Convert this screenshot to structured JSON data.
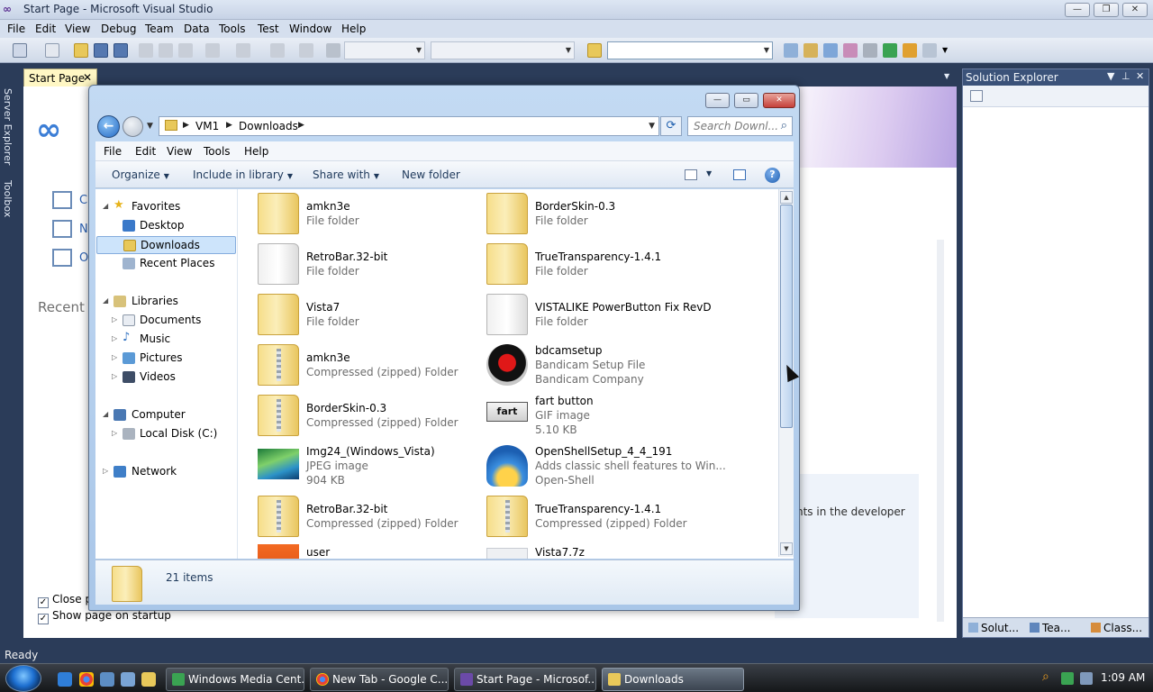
{
  "vs": {
    "window_title": "Start Page - Microsoft Visual Studio",
    "menu": [
      "File",
      "Edit",
      "View",
      "Debug",
      "Team",
      "Data",
      "Tools",
      "Test",
      "Window",
      "Help"
    ],
    "left_rail": [
      "Server Explorer",
      "Toolbox"
    ],
    "doc_tab": "Start Page",
    "start_page": {
      "links": [
        "C",
        "N",
        "O"
      ],
      "recent_label": "Recent P",
      "latest_text": "nts in the developer",
      "close_page_label": "Close p",
      "close_page_checked": true,
      "show_page_label": "Show page on startup",
      "show_page_checked": true
    },
    "solution_explorer": {
      "title": "Solution Explorer",
      "tabs": [
        "Solut...",
        "Tea...",
        "Class..."
      ]
    },
    "status": "Ready"
  },
  "explorer": {
    "breadcrumb": [
      "VM1",
      "Downloads"
    ],
    "search_placeholder": "Search Downl...",
    "menu": [
      "File",
      "Edit",
      "View",
      "Tools",
      "Help"
    ],
    "commands": [
      "Organize",
      "Include in library",
      "Share with",
      "New folder"
    ],
    "nav": {
      "favorites_label": "Favorites",
      "favorites": [
        "Desktop",
        "Downloads",
        "Recent Places"
      ],
      "selected": "Downloads",
      "libraries_label": "Libraries",
      "libraries": [
        "Documents",
        "Music",
        "Pictures",
        "Videos"
      ],
      "computer_label": "Computer",
      "computer_items": [
        "Local Disk (C:)"
      ],
      "network_label": "Network"
    },
    "files": [
      {
        "name": "amkn3e",
        "type": "File folder"
      },
      {
        "name": "BorderSkin-0.3",
        "type": "File folder"
      },
      {
        "name": "RetroBar.32-bit",
        "type": "File folder"
      },
      {
        "name": "TrueTransparency-1.4.1",
        "type": "File folder"
      },
      {
        "name": "Vista7",
        "type": "File folder"
      },
      {
        "name": "VISTALIKE PowerButton Fix RevD",
        "type": "File folder"
      },
      {
        "name": "amkn3e",
        "type": "Compressed (zipped) Folder"
      },
      {
        "name": "bdcamsetup",
        "type": "Bandicam Setup File",
        "extra": "Bandicam Company"
      },
      {
        "name": "BorderSkin-0.3",
        "type": "Compressed (zipped) Folder"
      },
      {
        "name": "fart button",
        "type": "GIF image",
        "extra": "5.10 KB"
      },
      {
        "name": "Img24_(Windows_Vista)",
        "type": "JPEG image",
        "extra": "904 KB"
      },
      {
        "name": "OpenShellSetup_4_4_191",
        "type": "Adds classic shell features to Win...",
        "extra": "Open-Shell"
      },
      {
        "name": "RetroBar.32-bit",
        "type": "Compressed (zipped) Folder"
      },
      {
        "name": "TrueTransparency-1.4.1",
        "type": "Compressed (zipped) Folder"
      },
      {
        "name": "user",
        "type": ""
      },
      {
        "name": "Vista7.7z",
        "type": ""
      }
    ],
    "fart_icon_text": "fart",
    "item_count": "21 items"
  },
  "taskbar": {
    "buttons": [
      "Windows Media Cent...",
      "New Tab - Google C...",
      "Start Page - Microsof...",
      "Downloads"
    ],
    "active": "Downloads",
    "clock": "1:09 AM"
  }
}
